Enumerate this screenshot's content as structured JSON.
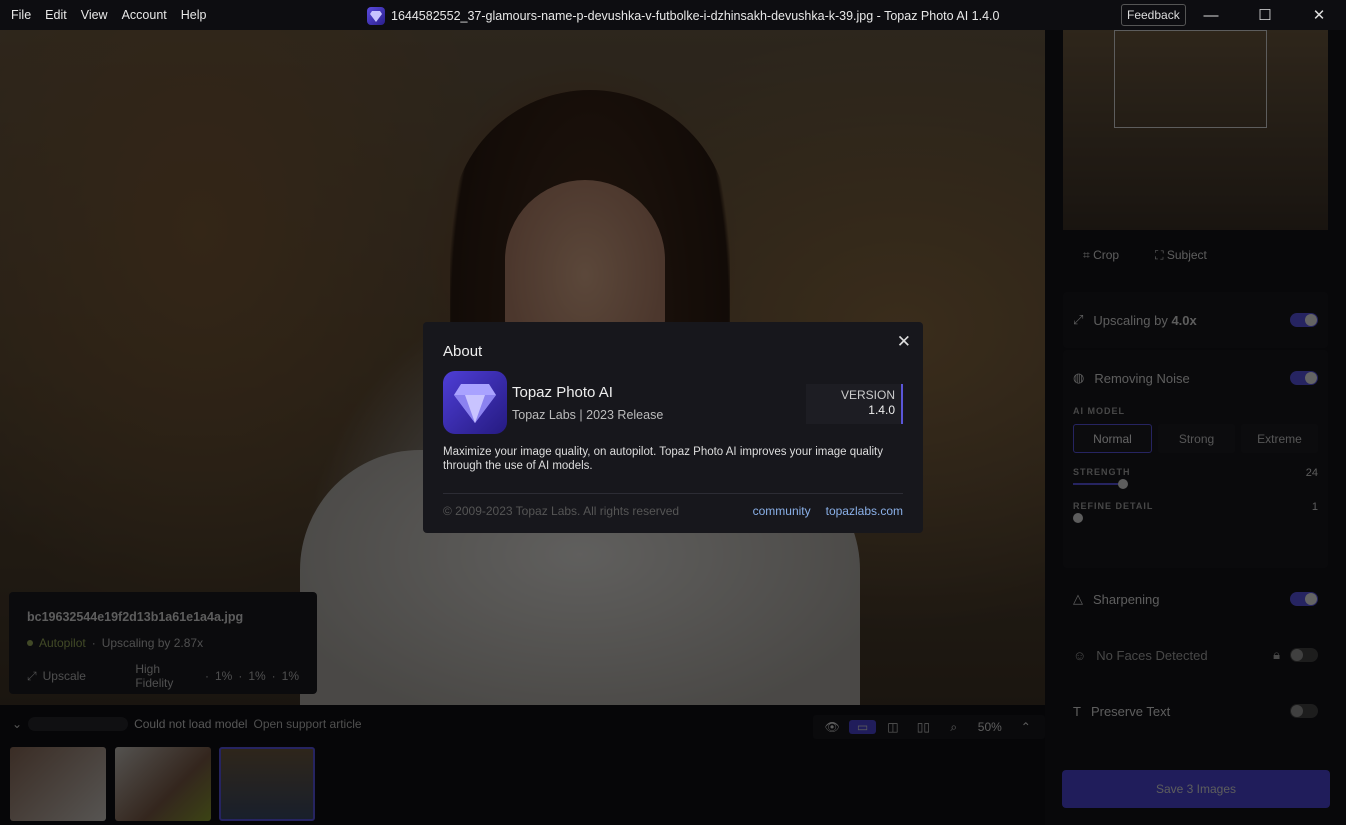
{
  "menu": [
    "File",
    "Edit",
    "View",
    "Account",
    "Help"
  ],
  "window_title": "1644582552_37-glamours-name-p-devushka-v-futbolke-i-dzhinsakh-devushka-k-39.jpg - Topaz Photo AI 1.4.0",
  "feedback": "Feedback",
  "info_card": {
    "filename": "bc19632544e19f2d13b1a61e1a4a.jpg",
    "autopilot": "Autopilot",
    "upscaling": "Upscaling by 2.87x",
    "upscale": "Upscale",
    "fidelity": "High Fidelity",
    "v1": "1%",
    "v2": "1%",
    "v3": "1%"
  },
  "status": {
    "message": "Could not load model",
    "link": "Open support article"
  },
  "view": {
    "zoom": "50%"
  },
  "right": {
    "tools": [
      "Crop",
      "Subject"
    ],
    "upscaling": {
      "label": "Upscaling by ",
      "value": "4.0x"
    },
    "noise": {
      "label": "Removing Noise",
      "ai_model_caption": "AI MODEL",
      "models": [
        "Normal",
        "Strong",
        "Extreme"
      ],
      "selected": "Normal",
      "strength_caption": "STRENGTH",
      "strength": "24",
      "strength_fraction": 0.24,
      "refine_caption": "REFINE DETAIL",
      "refine": "1"
    },
    "sharpening": "Sharpening",
    "faces": "No Faces Detected",
    "text": "Preserve Text",
    "save": "Save 3 Images"
  },
  "about": {
    "title": "About",
    "app": "Topaz Photo AI",
    "company": "Topaz Labs",
    "release": "2023 Release",
    "version_label": "VERSION",
    "version": "1.4.0",
    "description": "Maximize your image quality, on autopilot. Topaz Photo AI improves your image quality through the use of AI models.",
    "copyright": "© 2009-2023 Topaz Labs. All rights reserved",
    "links": [
      "community",
      "topazlabs.com"
    ]
  }
}
